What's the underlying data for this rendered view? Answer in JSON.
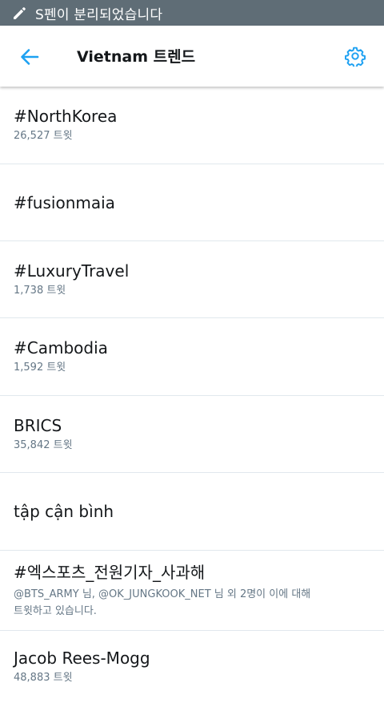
{
  "status_bar": {
    "icon": "pen-icon",
    "message": "S펜이 분리되었습니다",
    "background": "#5f6d76"
  },
  "app_bar": {
    "back_icon": "arrow-left-icon",
    "title": "Vietnam 트렌드",
    "settings_icon": "gear-icon",
    "accent": "#1da1f2"
  },
  "trends": [
    {
      "name": "#NorthKorea",
      "meta": "26,527 트윗"
    },
    {
      "name": "#fusionmaia",
      "meta": ""
    },
    {
      "name": "#LuxuryTravel",
      "meta": "1,738 트윗"
    },
    {
      "name": "#Cambodia",
      "meta": "1,592 트윗"
    },
    {
      "name": "BRICS",
      "meta": "35,842 트윗"
    },
    {
      "name": "tập cận bình",
      "meta": ""
    },
    {
      "name": "#엑스포츠_전원기자_사과해",
      "meta": "",
      "context_line1": "@BTS_ARMY 님, @OK_JUNGKOOK_NET 님 외 2명이 이에 대해",
      "context_line2": "트윗하고 있습니다."
    },
    {
      "name": "Jacob Rees-Mogg",
      "meta": "48,883 트윗"
    }
  ]
}
